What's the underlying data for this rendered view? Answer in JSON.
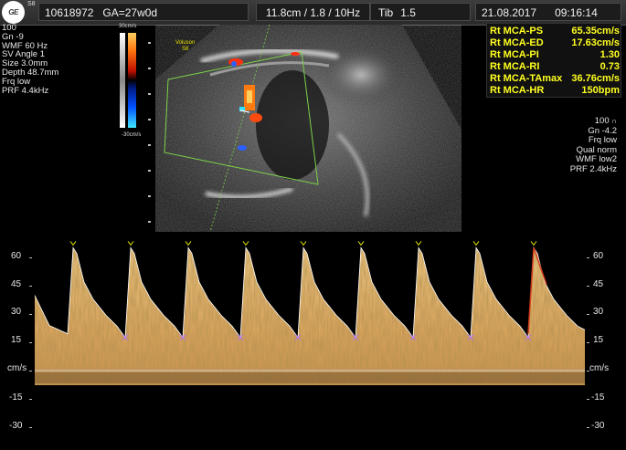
{
  "header": {
    "logo_text": "GE",
    "model": "S8",
    "patient_id": "10618972",
    "gestational_age": "GA=27w0d",
    "depth_info": "11.8cm / 1.8 / 10Hz",
    "probe_info": "Tib",
    "probe_value": "1.5",
    "date": "21.08.2017",
    "time": "09:16:14"
  },
  "params_left": [
    "100",
    "Gn  -9",
    "WMF 60 Hz",
    "SV Angle  1",
    "Size  3.0mm",
    "Depth 48.7mm",
    "Frq low",
    "PRF  4.4kHz"
  ],
  "colorbar": {
    "top_label": "30cm/s",
    "bottom_label": "-30cm/s"
  },
  "bmode": {
    "brand": "Voluson",
    "brand_sub": "S8"
  },
  "measurements": [
    {
      "label": "Rt MCA-PS",
      "value": "65.35cm/s"
    },
    {
      "label": "Rt MCA-ED",
      "value": "17.63cm/s"
    },
    {
      "label": "Rt MCA-PI",
      "value": "1.30"
    },
    {
      "label": "Rt MCA-RI",
      "value": "0.73"
    },
    {
      "label": "Rt MCA-TAmax",
      "value": "36.76cm/s"
    },
    {
      "label": "Rt MCA-HR",
      "value": "150bpm"
    }
  ],
  "params_right": [
    "100 ",
    "Gn -4.2",
    "Frq low",
    "Qual norm",
    "WMF low2",
    "PRF  2.4kHz"
  ],
  "spectrum": {
    "scale_left": [
      "60",
      "45",
      "30",
      "15",
      "cm/s",
      "-15",
      "-30"
    ],
    "scale_right": [
      "60",
      "45",
      "30",
      "15",
      "cm/s",
      "-15",
      "-30"
    ],
    "peak_velocity_cms": 65.35,
    "end_diastolic_velocity_cms": 17.63,
    "cycle_count": 9,
    "colors": {
      "waveform": "#f0c070",
      "trace": "#ffffff",
      "baseline": "#cfcfcf",
      "marker": "#e6e600"
    }
  }
}
